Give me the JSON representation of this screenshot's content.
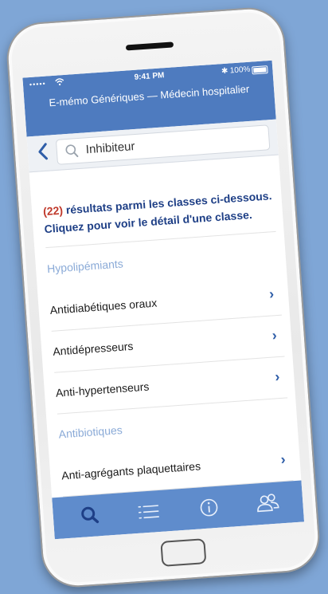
{
  "status": {
    "signal": "•••••",
    "time": "9:41 PM",
    "bluetooth": "✱",
    "battery": "100%"
  },
  "header": {
    "title": "E-mémo Génériques — Médecin hospitalier"
  },
  "search": {
    "value": "Inhibiteur"
  },
  "results": {
    "count": "(22)",
    "line1": " résultats parmi les classes ci-dessous.",
    "line2": "Cliquez pour voir le détail d'une classe."
  },
  "classes": [
    {
      "label": "Hypolipémiants",
      "enabled": false
    },
    {
      "label": "Antidiabétiques oraux",
      "enabled": true
    },
    {
      "label": "Antidépresseurs",
      "enabled": true
    },
    {
      "label": "Anti-hypertenseurs",
      "enabled": true
    },
    {
      "label": "Antibiotiques",
      "enabled": false
    },
    {
      "label": "Anti-agrégants plaquettaires",
      "enabled": true
    }
  ],
  "tabs": [
    {
      "name": "search-tab",
      "icon": "search-icon"
    },
    {
      "name": "list-tab",
      "icon": "list-icon"
    },
    {
      "name": "info-tab",
      "icon": "info-icon"
    },
    {
      "name": "users-tab",
      "icon": "users-icon"
    }
  ],
  "colors": {
    "header": "#4e7bbf",
    "accent": "#2f5ea8",
    "count": "#c0392b",
    "muted": "#8aaad7"
  }
}
